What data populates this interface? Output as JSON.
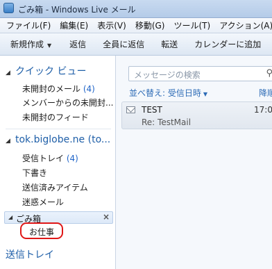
{
  "window": {
    "title": "ごみ箱 - Windows Live メール"
  },
  "menubar": [
    {
      "label": "ファイル(F)"
    },
    {
      "label": "編集(E)"
    },
    {
      "label": "表示(V)"
    },
    {
      "label": "移動(G)"
    },
    {
      "label": "ツール(T)"
    },
    {
      "label": "アクション(A)"
    }
  ],
  "toolbar": {
    "new_label": "新規作成",
    "reply_label": "返信",
    "reply_all_label": "全員に返信",
    "forward_label": "転送",
    "add_calendar_label": "カレンダーに追加"
  },
  "sidebar": {
    "quick_view": {
      "title": "クイック ビュー",
      "items": [
        {
          "label": "未開封のメール",
          "count": "(4)"
        },
        {
          "label": "メンバーからの未開封..."
        },
        {
          "label": "未開封のフィード"
        }
      ]
    },
    "account": {
      "title": "tok.biglobe.ne (to...",
      "items": [
        {
          "label": "受信トレイ",
          "count": "(4)"
        },
        {
          "label": "下書き"
        },
        {
          "label": "送信済みアイテム"
        },
        {
          "label": "迷惑メール"
        }
      ],
      "trash": {
        "label": "ごみ箱",
        "close": "×"
      },
      "subfolder": {
        "label": "お仕事"
      }
    },
    "outbox_label": "送信トレイ"
  },
  "main": {
    "search_placeholder": "メッセージの検索",
    "sort_label": "並べ替え: 受信日時",
    "sort_right": "降順",
    "messages": [
      {
        "subject": "TEST",
        "time": "17:0",
        "preview": "Re: TestMail"
      }
    ]
  },
  "colors": {
    "accent": "#1f5fa8",
    "highlight_ring": "#e01717"
  }
}
